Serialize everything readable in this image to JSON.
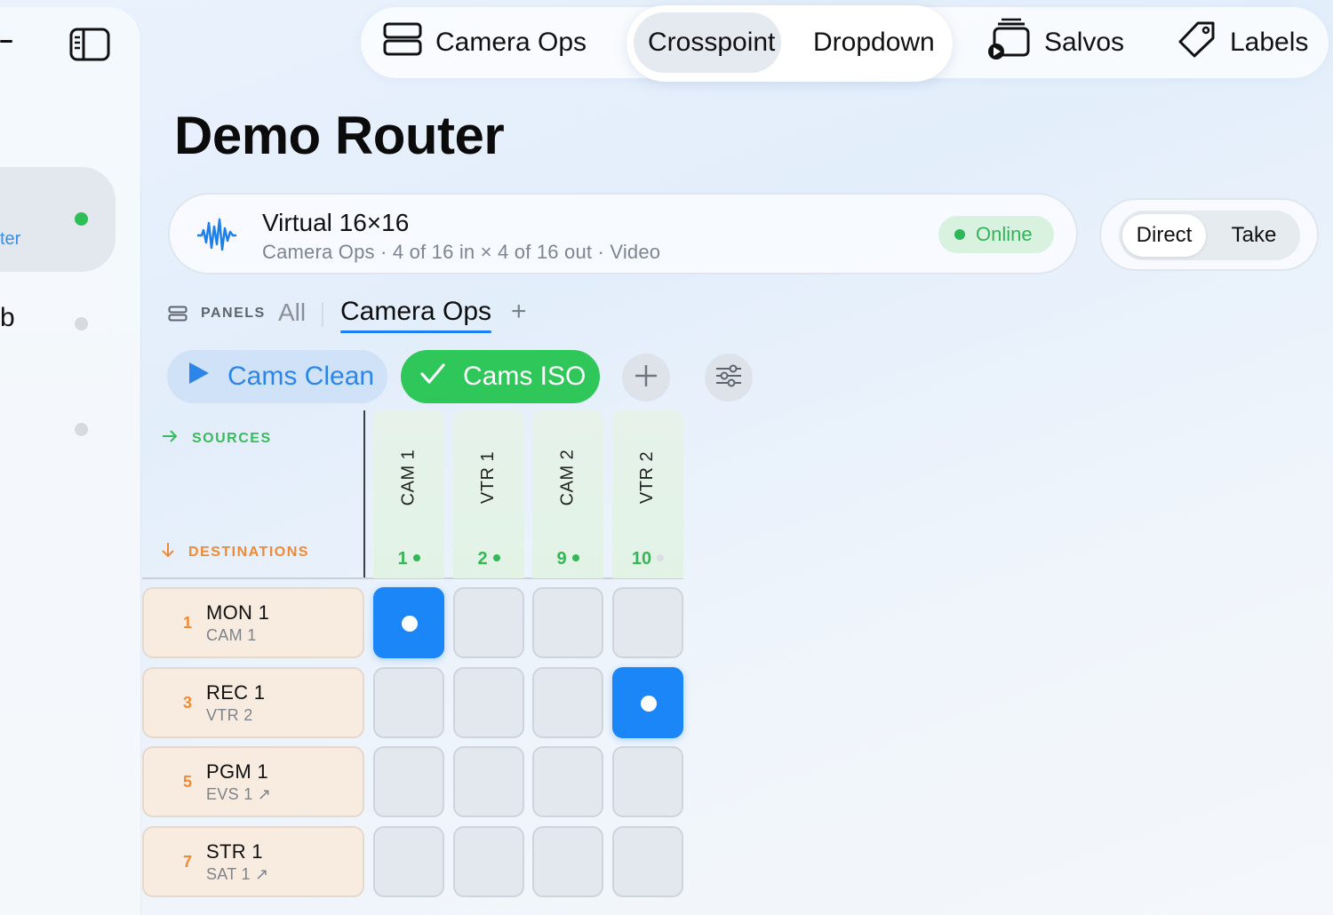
{
  "sidebar": {
    "active_item_label_partial": "ter",
    "second_item_label_partial": "b",
    "status_colors": [
      "#2fbe55",
      "#d6dbe0",
      "#d6dbe0"
    ]
  },
  "topnav": {
    "items": [
      {
        "label": "Camera Ops",
        "icon": "panels-icon"
      },
      {
        "label": "Crosspoint",
        "active": true
      },
      {
        "label": "Dropdown"
      },
      {
        "label": "Salvos",
        "icon": "salvos-icon"
      },
      {
        "label": "Labels",
        "icon": "tag-icon"
      }
    ]
  },
  "page": {
    "title": "Demo Router"
  },
  "router": {
    "name": "Virtual 16×16",
    "subtitle": "Camera Ops · 4 of 16 in × 4 of 16 out · Video",
    "status": "Online",
    "status_color": "#2fb657"
  },
  "mode": {
    "options": [
      "Direct",
      "Take"
    ],
    "selected": "Direct"
  },
  "panels": {
    "label": "PANELS",
    "tabs": [
      "All",
      "Camera Ops"
    ],
    "active_tab": "Camera Ops",
    "add": "+"
  },
  "salvos": {
    "chips": [
      {
        "label": "Cams Clean",
        "state": "play"
      },
      {
        "label": "Cams ISO",
        "state": "active"
      }
    ]
  },
  "matrix": {
    "sources_label": "SOURCES",
    "destinations_label": "DESTINATIONS",
    "sources": [
      {
        "name": "CAM 1",
        "num": "1",
        "signal": true
      },
      {
        "name": "VTR 1",
        "num": "2",
        "signal": true
      },
      {
        "name": "CAM 2",
        "num": "9",
        "signal": true
      },
      {
        "name": "VTR 2",
        "num": "10",
        "signal": false
      }
    ],
    "destinations": [
      {
        "num": "1",
        "name": "MON 1",
        "source": "CAM 1",
        "routed_col": 0
      },
      {
        "num": "3",
        "name": "REC 1",
        "source": "VTR 2",
        "routed_col": 3
      },
      {
        "num": "5",
        "name": "PGM 1",
        "source": "EVS 1 ↗",
        "routed_col": -1
      },
      {
        "num": "7",
        "name": "STR 1",
        "source": "SAT 1 ↗",
        "routed_col": -1
      }
    ]
  }
}
